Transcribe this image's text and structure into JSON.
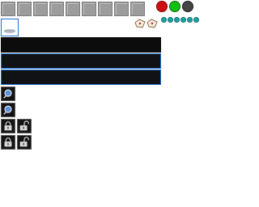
{
  "toolbar": {
    "square_buttons": [
      "btn1",
      "btn2",
      "btn3",
      "btn4",
      "btn5",
      "btn6",
      "btn7",
      "btn8",
      "btn9"
    ]
  },
  "window_dots": [
    {
      "name": "red-dot",
      "color": "#d01010"
    },
    {
      "name": "green-dot",
      "color": "#12c012"
    },
    {
      "name": "dark-dot",
      "color": "#444444"
    }
  ],
  "tags": [
    "tag-icon-1",
    "tag-icon-2"
  ],
  "teal_dots_count": 6,
  "thumbnail": {
    "icon": "image-preview-icon",
    "accent": "#1e6fd1"
  },
  "bars": [
    {
      "name": "bar-1",
      "selected": false
    },
    {
      "name": "bar-2",
      "selected": true
    },
    {
      "name": "bar-3",
      "selected": true
    }
  ],
  "tools": {
    "search_buttons": [
      "search-icon",
      "search-icon"
    ],
    "lock_buttons": [
      "lock-closed-icon",
      "lock-open-icon",
      "lock-closed-icon",
      "lock-open-icon"
    ]
  },
  "colors": {
    "accent": "#1e6fd1",
    "bar_bg": "#0c0c0c",
    "button_gray": "#9c9c9c",
    "teal": "#1fa3a3"
  }
}
